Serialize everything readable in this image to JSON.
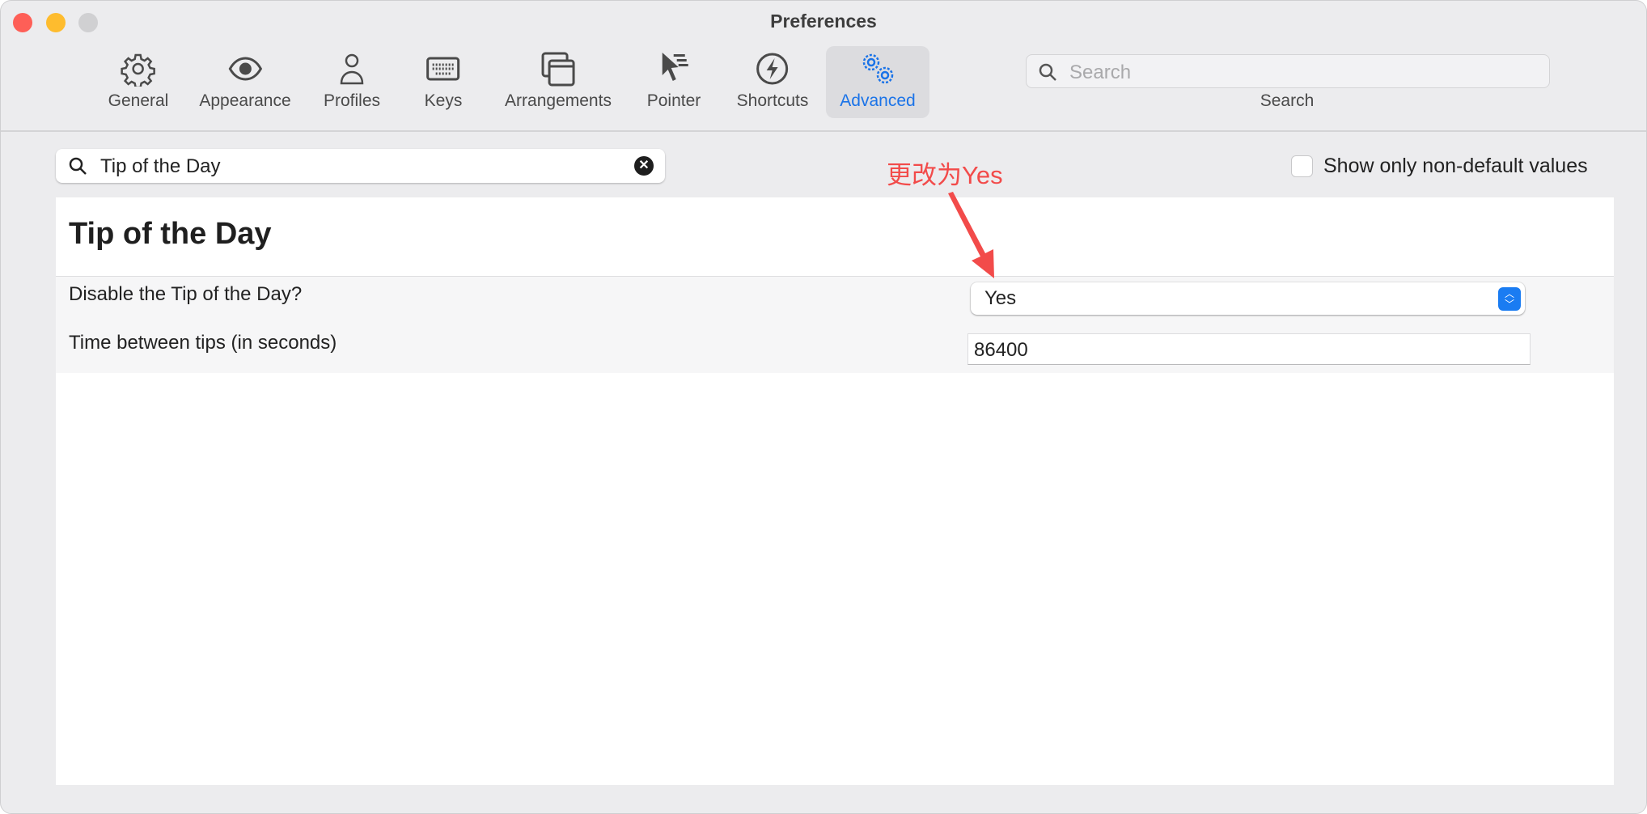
{
  "window": {
    "title": "Preferences",
    "colors": {
      "close": "#fe5f57",
      "minimize": "#febc2e",
      "zoom": "#d0d0d2",
      "accent": "#1a7cf2",
      "annotation": "#f24b4a"
    }
  },
  "toolbar": {
    "items": [
      {
        "label": "General",
        "icon": "gear-icon"
      },
      {
        "label": "Appearance",
        "icon": "eye-icon"
      },
      {
        "label": "Profiles",
        "icon": "person-icon"
      },
      {
        "label": "Keys",
        "icon": "keyboard-icon"
      },
      {
        "label": "Arrangements",
        "icon": "windows-icon"
      },
      {
        "label": "Pointer",
        "icon": "pointer-icon"
      },
      {
        "label": "Shortcuts",
        "icon": "bolt-icon"
      },
      {
        "label": "Advanced",
        "icon": "gears-icon",
        "active": true
      }
    ],
    "search": {
      "placeholder": "Search",
      "label": "Search"
    }
  },
  "filter": {
    "value": "Tip of the Day",
    "show_non_default_label": "Show only non-default values",
    "show_non_default_checked": false
  },
  "annotation": {
    "text": "更改为Yes"
  },
  "section": {
    "title": "Tip of the Day",
    "rows": [
      {
        "label": "Disable the Tip of the Day?",
        "value": "Yes"
      },
      {
        "label": "Time between tips (in seconds)",
        "value": "86400"
      }
    ]
  }
}
